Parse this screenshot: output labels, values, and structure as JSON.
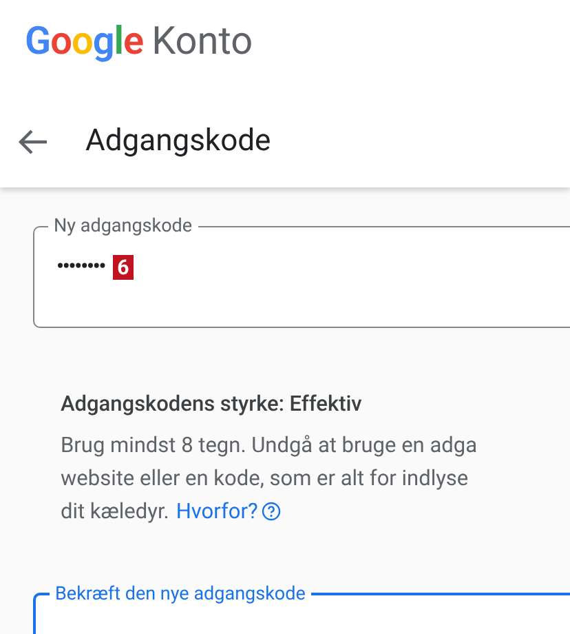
{
  "logo": {
    "brand": "Google",
    "product": "Konto"
  },
  "page_title": "Adgangskode",
  "new_password_field": {
    "label": "Ny adgangskode",
    "value": "••••••••",
    "focused": false
  },
  "annotation_marker": "6",
  "strength": "Adgangskodens styrke: Effektiv",
  "advice_lines": [
    "Brug mindst 8 tegn. Undgå at bruge en adga",
    "website eller en kode, som er alt for indlyse",
    "dit kæledyr."
  ],
  "advice_link": "Hvorfor?",
  "confirm_field": {
    "label": "Bekræft den nye adgangskode",
    "focused": true
  }
}
